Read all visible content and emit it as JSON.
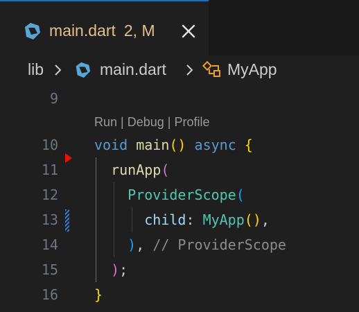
{
  "tab": {
    "file_name": "main.dart",
    "badge": "2, M",
    "icon": "dart-icon",
    "close_icon": "close-icon",
    "accent": "#0078d4",
    "title_color": "#e2c08d"
  },
  "breadcrumb": {
    "items": [
      "lib",
      "main.dart",
      "MyApp"
    ],
    "icons": [
      "chevron-right-icon",
      "dart-icon",
      "class-icon"
    ]
  },
  "editor": {
    "codelens": {
      "run": "Run",
      "debug": "Debug",
      "profile": "Profile",
      "sep": " | "
    },
    "lines": [
      {
        "number": "9"
      },
      {
        "number": "10",
        "tokens": [
          "void",
          "main",
          "()",
          "async",
          "{"
        ]
      },
      {
        "number": "11",
        "tokens": [
          "runApp",
          "("
        ]
      },
      {
        "number": "12",
        "tokens": [
          "ProviderScope",
          "("
        ]
      },
      {
        "number": "13",
        "tokens": [
          "child",
          ":",
          "MyApp",
          "()",
          ","
        ]
      },
      {
        "number": "14",
        "tokens": [
          ")",
          ",",
          "// ProviderScope"
        ]
      },
      {
        "number": "15",
        "tokens": [
          ")",
          ";"
        ]
      },
      {
        "number": "16",
        "tokens": [
          "}"
        ]
      }
    ],
    "gutter_markers": {
      "breakpoint_line": "11",
      "modified_line": "13"
    },
    "colors": {
      "keyword": "#569cd6",
      "function": "#dcdcaa",
      "type": "#4ec9b0",
      "comment": "#8b8b8b"
    }
  }
}
